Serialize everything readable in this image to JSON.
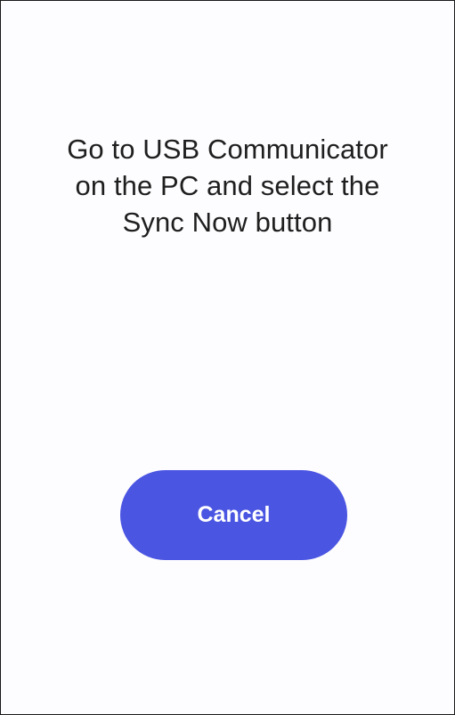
{
  "dialog": {
    "message_lines": [
      "Go to USB Communicator",
      "on the PC and select the",
      "Sync Now button"
    ],
    "cancel_label": "Cancel"
  },
  "colors": {
    "button_background": "#4a55e2",
    "button_text": "#ffffff",
    "text": "#1f1f1f",
    "background": "#fdfcfe"
  }
}
